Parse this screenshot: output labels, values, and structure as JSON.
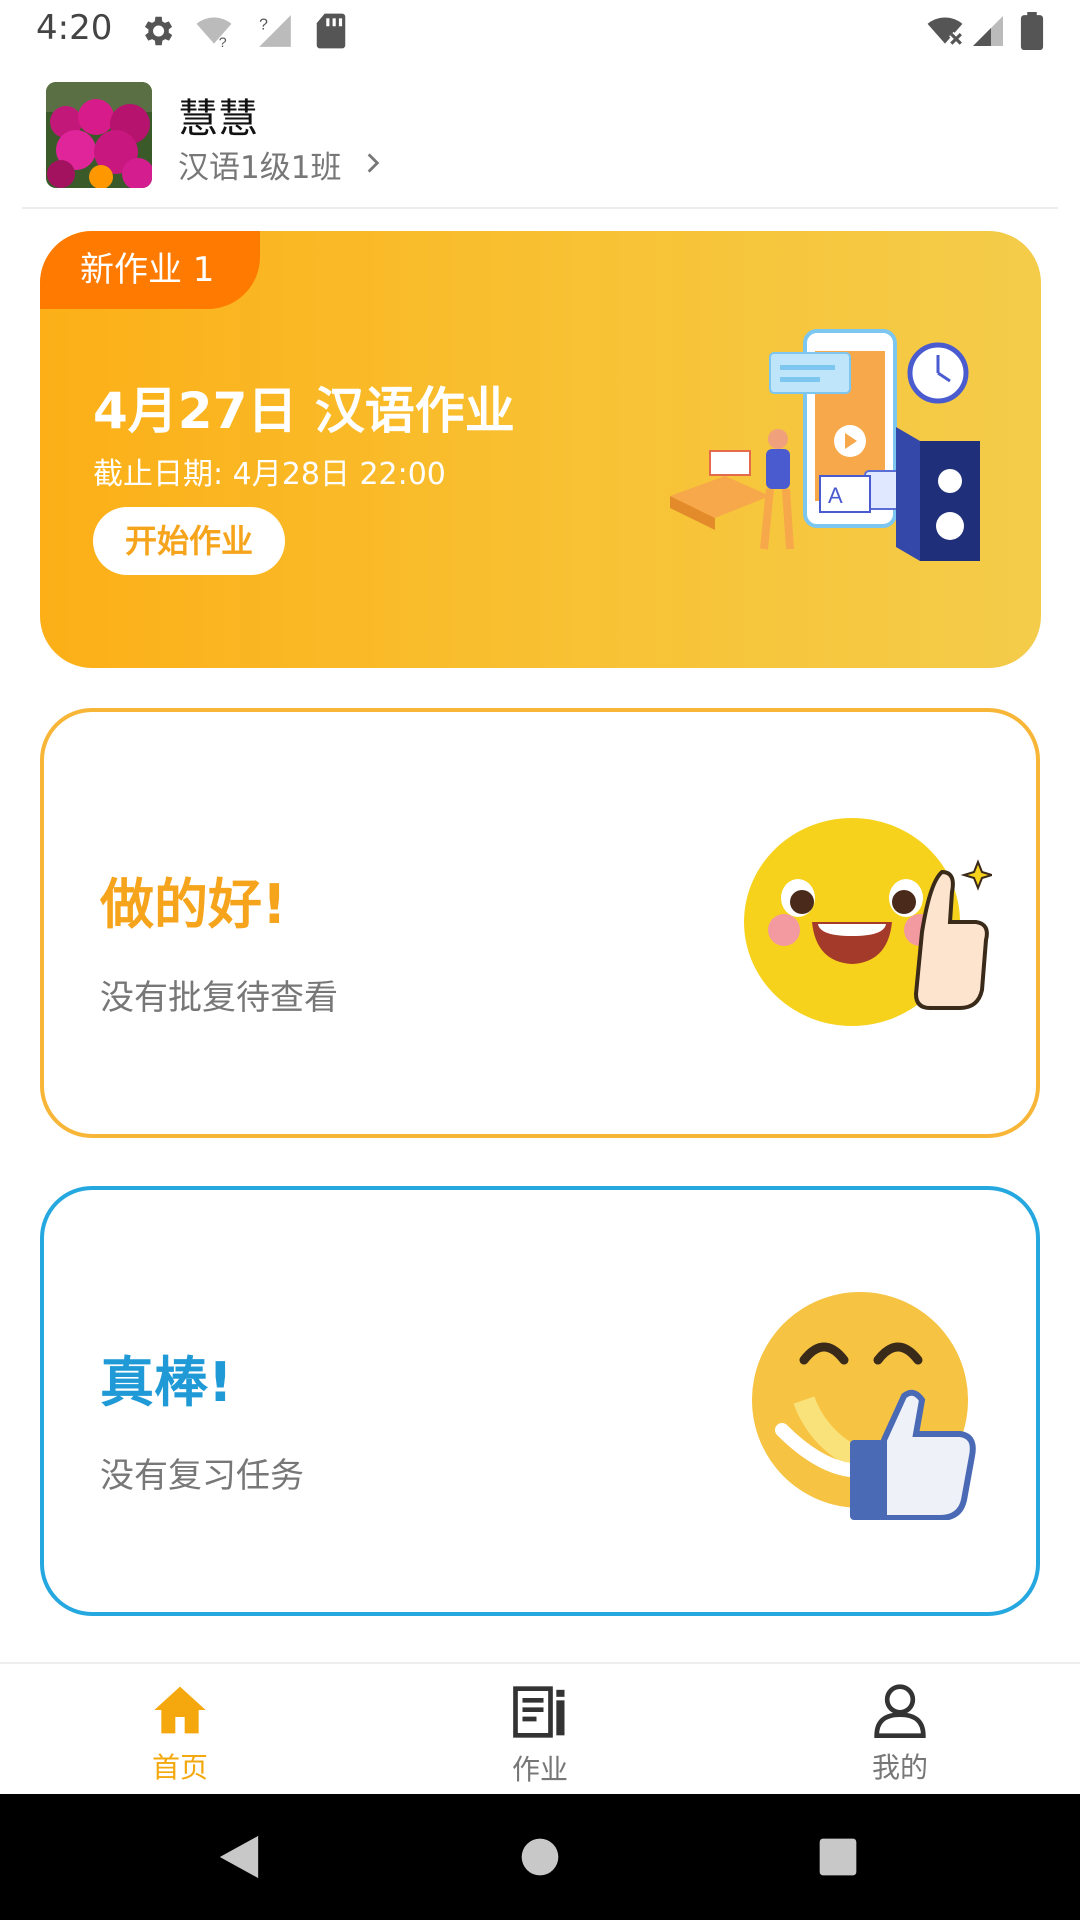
{
  "status_bar": {
    "time": "4:20",
    "icons": [
      "gear-icon",
      "wifi-question-icon",
      "signal-question-icon",
      "sd-card-icon",
      "wifi-x-icon",
      "signal-icon",
      "battery-icon"
    ]
  },
  "header": {
    "username": "慧慧",
    "class_name": "汉语1级1班"
  },
  "homework_banner": {
    "badge": "新作业 1",
    "title": "4月27日 汉语作业",
    "deadline": "截止日期: 4月28日 22:00",
    "start_button": "开始作业",
    "colors": {
      "start": "#fcaf17",
      "end": "#f4cc4a",
      "badge": "#ff7a00"
    }
  },
  "cards": [
    {
      "title": "做的好!",
      "subtitle": "没有批复待查看",
      "accent": "#f6a41b"
    },
    {
      "title": "真棒!",
      "subtitle": "没有复习任务",
      "accent": "#1f9ad6"
    }
  ],
  "bottom_nav": [
    {
      "label": "首页",
      "icon": "home-icon",
      "active": true
    },
    {
      "label": "作业",
      "icon": "homework-icon",
      "active": false
    },
    {
      "label": "我的",
      "icon": "profile-icon",
      "active": false
    }
  ]
}
